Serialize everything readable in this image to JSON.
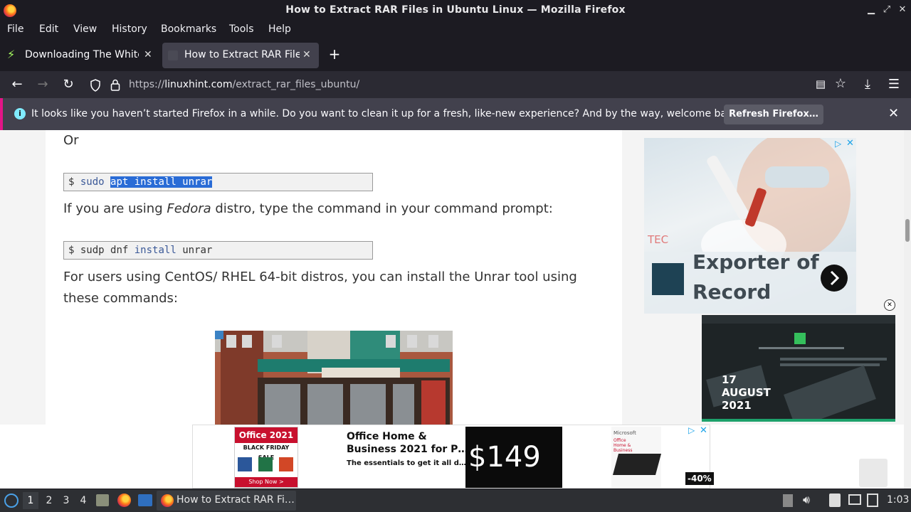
{
  "window": {
    "title": "How to Extract RAR Files in Ubuntu Linux — Mozilla Firefox",
    "controls": [
      "minimize",
      "maximize",
      "close"
    ]
  },
  "menu": {
    "items": [
      "File",
      "Edit",
      "View",
      "History",
      "Bookmarks",
      "Tools",
      "Help"
    ]
  },
  "tabs": [
    {
      "label": "Downloading The White",
      "active": false
    },
    {
      "label": "How to Extract RAR Files",
      "active": true
    }
  ],
  "urlbar": {
    "prefix": "https://",
    "domain": "linuxhint.com",
    "path": "/extract_rar_files_ubuntu/"
  },
  "notification": {
    "message": "It looks like you haven’t started Firefox in a while. Do you want to clean it up for a fresh, like-new experience? And by the way, welcome back!",
    "button": "Refresh Firefox…"
  },
  "article": {
    "or_text": "Or",
    "cmd1": {
      "prompt": "$",
      "part1": "sudo",
      "selected": "apt install unrar"
    },
    "fedora_pre": "If you are using ",
    "fedora_em": "Fedora",
    "fedora_post": " distro, type the command in your command prompt:",
    "cmd2": {
      "prompt": "$",
      "part1": "sudp dnf",
      "part2": "install",
      "part3": "unrar"
    },
    "centos_line1": "For users using CentOS/ RHEL 64-bit distros, you can install the Unrar tool using",
    "centos_line2": "these commands:"
  },
  "ads": {
    "side_ad": {
      "logo": "TEC",
      "headline_1": "Exporter of",
      "headline_2": "Record"
    },
    "video_ad": {
      "date_1": "17",
      "date_2": "AUGUST",
      "date_3": "2021"
    },
    "bottom_ad": {
      "brand": "Office 2021",
      "sale": "BLACK FRIDAY SALE",
      "shop": "Shop Now >",
      "title_1": "Office Home &",
      "title_2": "Business 2021 for P…",
      "subtitle": "The essentials to get it all d…",
      "price": "$149",
      "ms_label": "Microsoft",
      "box_label": "Office Home & Business",
      "discount": "-40%"
    }
  },
  "taskbar": {
    "workspaces": [
      "1",
      "2",
      "3",
      "4"
    ],
    "window_label": "How to Extract RAR Fi…",
    "clock": "1:03"
  },
  "colors": {
    "accent_selection": "#2a6cd6",
    "chrome_dark": "#1c1b22",
    "notification_bg": "#42414d"
  }
}
